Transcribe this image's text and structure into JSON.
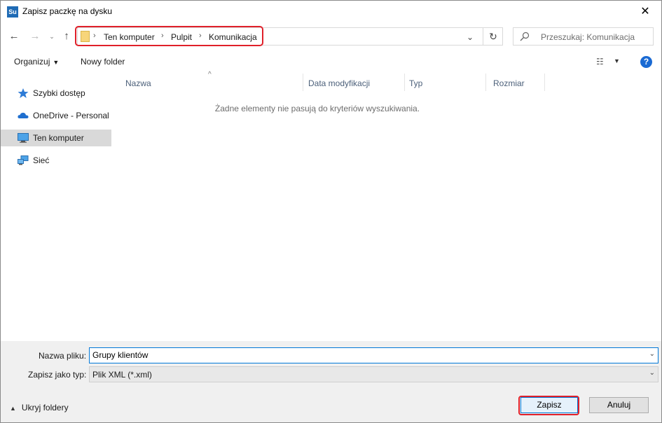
{
  "window": {
    "title": "Zapisz paczkę na dysku",
    "app_icon_text": "Su",
    "close_glyph": "✕"
  },
  "navigation": {
    "back_glyph": "←",
    "forward_glyph": "→",
    "recent_glyph": "⌄",
    "up_glyph": "↑",
    "breadcrumb": [
      "Ten komputer",
      "Pulpit",
      "Komunikacja"
    ],
    "separator": "›",
    "dropdown_glyph": "⌄",
    "refresh_glyph": "↻"
  },
  "search": {
    "placeholder": "Przeszukaj: Komunikacja"
  },
  "toolbar": {
    "organize_label": "Organizuj",
    "new_folder_label": "Nowy folder",
    "view_glyph": "☷",
    "help_glyph": "?"
  },
  "sidebar": {
    "items": [
      {
        "label": "Szybki dostęp",
        "icon": "star-icon",
        "selected": false
      },
      {
        "label": "OneDrive - Personal",
        "icon": "cloud-icon",
        "selected": false
      },
      {
        "label": "Ten komputer",
        "icon": "computer-icon",
        "selected": true
      },
      {
        "label": "Sieć",
        "icon": "network-icon",
        "selected": false
      }
    ]
  },
  "file_list": {
    "columns": [
      "Nazwa",
      "Data modyfikacji",
      "Typ",
      "Rozmiar"
    ],
    "sort_glyph": "^",
    "empty_message": "Żadne elementy nie pasują do kryteriów wyszukiwania."
  },
  "form": {
    "filename_label": "Nazwa pliku:",
    "filename_value": "Grupy klientów",
    "filetype_label": "Zapisz jako typ:",
    "filetype_value": "Plik XML (*.xml)",
    "hide_folders_label": "Ukryj foldery",
    "save_label": "Zapisz",
    "cancel_label": "Anuluj"
  },
  "colors": {
    "highlight_red": "#e0202a",
    "accent_blue": "#0078d7",
    "selected_bg": "#d9d9d9"
  }
}
